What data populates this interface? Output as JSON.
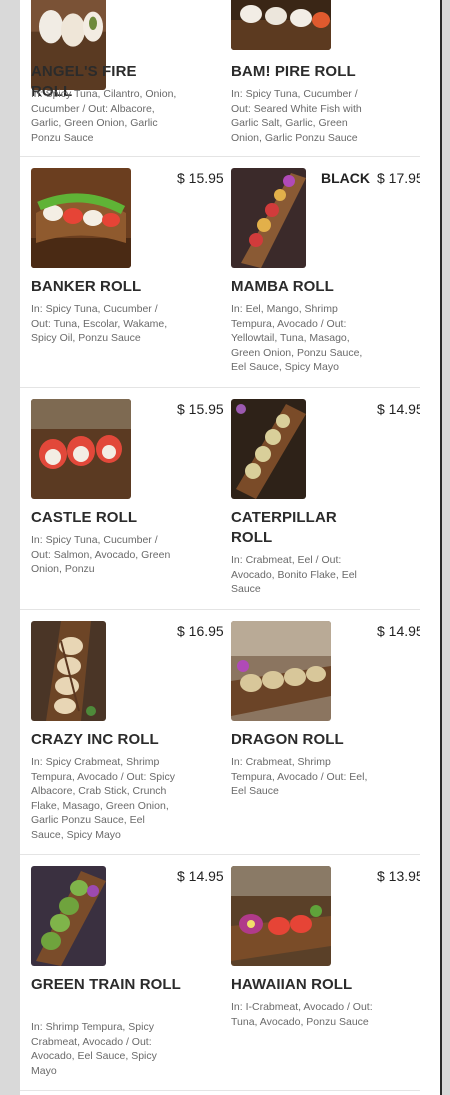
{
  "menu": {
    "items": [
      {
        "name": "ANGEL'S FIRE ROLL",
        "price": "",
        "desc": "In: Spicy Tuna, Cilantro, Onion, Cucumber / Out: Albacore, Garlic, Green Onion, Garlic Ponzu Sauce"
      },
      {
        "name": "BAM! PIRE ROLL",
        "price": "",
        "desc": "In: Spicy Tuna, Cucumber / Out: Seared White Fish with Garlic Salt, Garlic, Green Onion, Garlic Ponzu Sauce"
      },
      {
        "name": "BANKER ROLL",
        "price": "$ 15.95",
        "desc": "In: Spicy Tuna, Cucumber / Out: Tuna, Escolar, Wakame, Spicy Oil, Ponzu Sauce"
      },
      {
        "name": "MAMBA ROLL",
        "price": "$ 17.95",
        "tag": "BLACK",
        "desc": "In: Eel, Mango, Shrimp Tempura, Avocado / Out: Yellowtail, Tuna, Masago, Green Onion, Ponzu Sauce, Eel Sauce, Spicy Mayo"
      },
      {
        "name": "CASTLE ROLL",
        "price": "$ 15.95",
        "desc": "In: Spicy Tuna, Cucumber / Out: Salmon, Avocado, Green Onion, Ponzu"
      },
      {
        "name": "CATERPILLAR ROLL",
        "price": "$ 14.95",
        "desc": "In: Crabmeat, Eel / Out: Avocado, Bonito Flake, Eel Sauce"
      },
      {
        "name": "CRAZY INC ROLL",
        "price": "$ 16.95",
        "desc": "In: Spicy Crabmeat, Shrimp Tempura, Avocado / Out: Spicy Albacore, Crab Stick, Crunch Flake, Masago, Green Onion, Garlic Ponzu Sauce, Eel Sauce, Spicy Mayo"
      },
      {
        "name": "DRAGON ROLL",
        "price": "$ 14.95",
        "desc": "In: Crabmeat, Shrimp Tempura, Avocado / Out: Eel, Eel Sauce"
      },
      {
        "name": "GREEN TRAIN ROLL",
        "price": "$ 14.95",
        "desc": "In: Shrimp Tempura, Spicy Crabmeat, Avocado / Out: Avocado, Eel Sauce, Spicy Mayo"
      },
      {
        "name": "HAWAIIAN ROLL",
        "price": "$ 13.95",
        "desc": "In: I-Crabmeat, Avocado / Out: Tuna, Avocado, Ponzu Sauce"
      }
    ]
  },
  "colors": {
    "page_bg": "#ffffff",
    "outer_bg": "#d9d9d9",
    "title": "#2b2b2b",
    "desc": "#6a6a6a",
    "divider": "#e4e4e4"
  },
  "icons": [
    "sushi-photo"
  ]
}
